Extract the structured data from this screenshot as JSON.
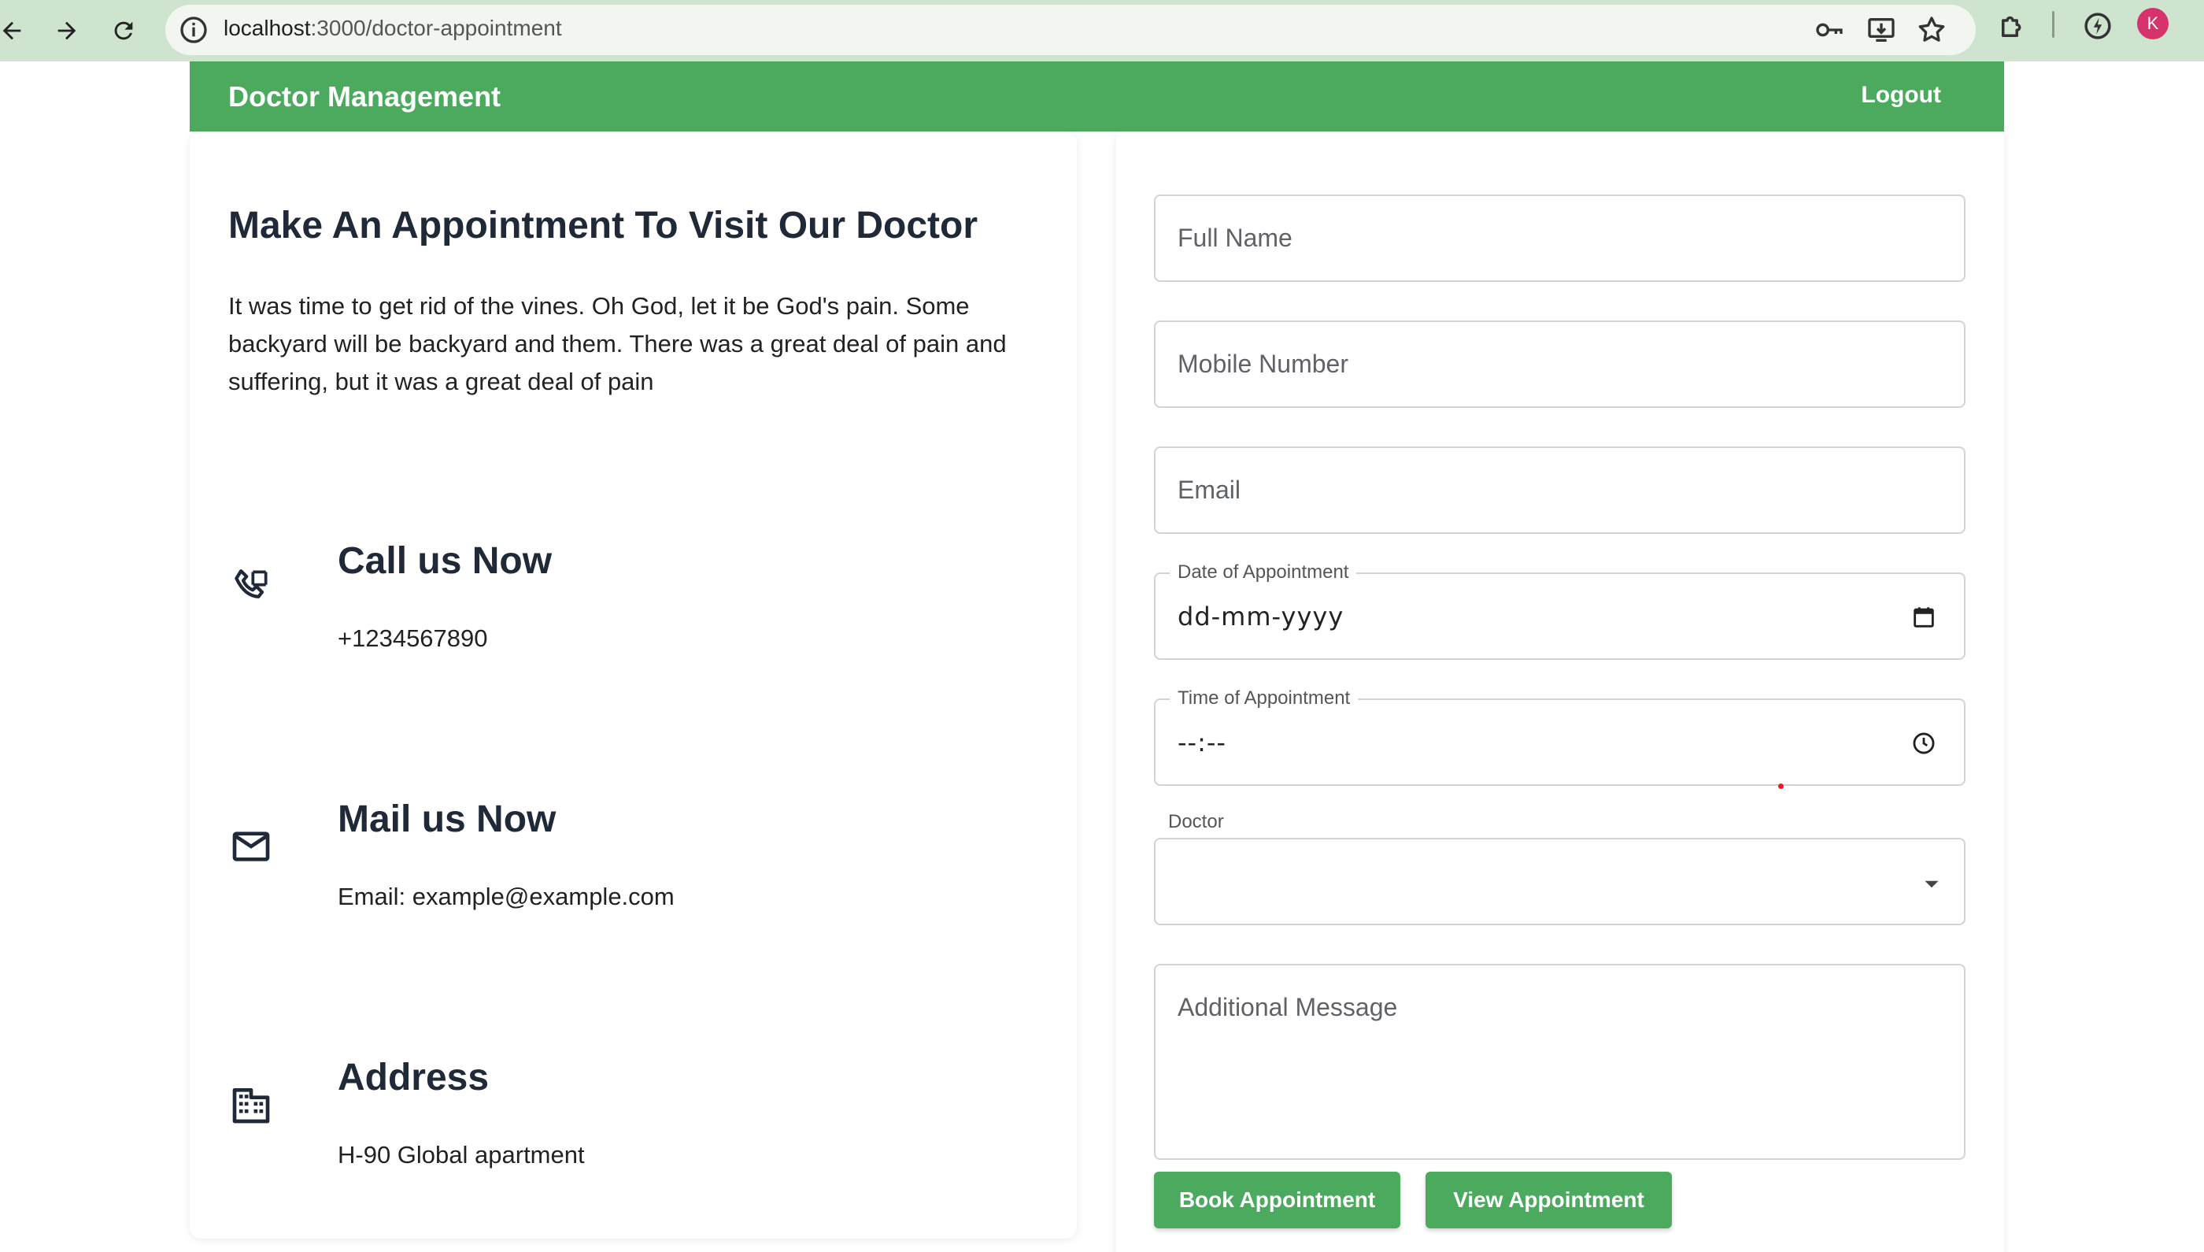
{
  "browser": {
    "url_host": "localhost",
    "url_path": ":3000/doctor-appointment",
    "profile_initial": "K"
  },
  "header": {
    "title": "Doctor Management",
    "logout_label": "Logout",
    "color": "#4caa5f"
  },
  "intro": {
    "heading": "Make An Appointment To Visit Our Doctor",
    "text": "It was time to get rid of the vines. Oh God, let it be God's pain. Some backyard will be backyard and them. There was a great deal of pain and suffering, but it was a great deal of pain"
  },
  "contacts": [
    {
      "title": "Call us Now",
      "value": "+1234567890",
      "icon": "phone-icon"
    },
    {
      "title": "Mail us Now",
      "value": "Email: example@example.com",
      "icon": "mail-icon"
    },
    {
      "title": "Address",
      "value": "H-90 Global apartment",
      "icon": "building-icon"
    }
  ],
  "form": {
    "full_name_placeholder": "Full Name",
    "mobile_placeholder": "Mobile Number",
    "email_placeholder": "Email",
    "date_label": "Date of Appointment",
    "date_value": "dd-mm-yyyy",
    "time_label": "Time of Appointment",
    "time_value": "--:--",
    "doctor_label": "Doctor",
    "doctor_value": "",
    "message_placeholder": "Additional Message",
    "book_label": "Book Appointment",
    "view_label": "View Appointment"
  }
}
